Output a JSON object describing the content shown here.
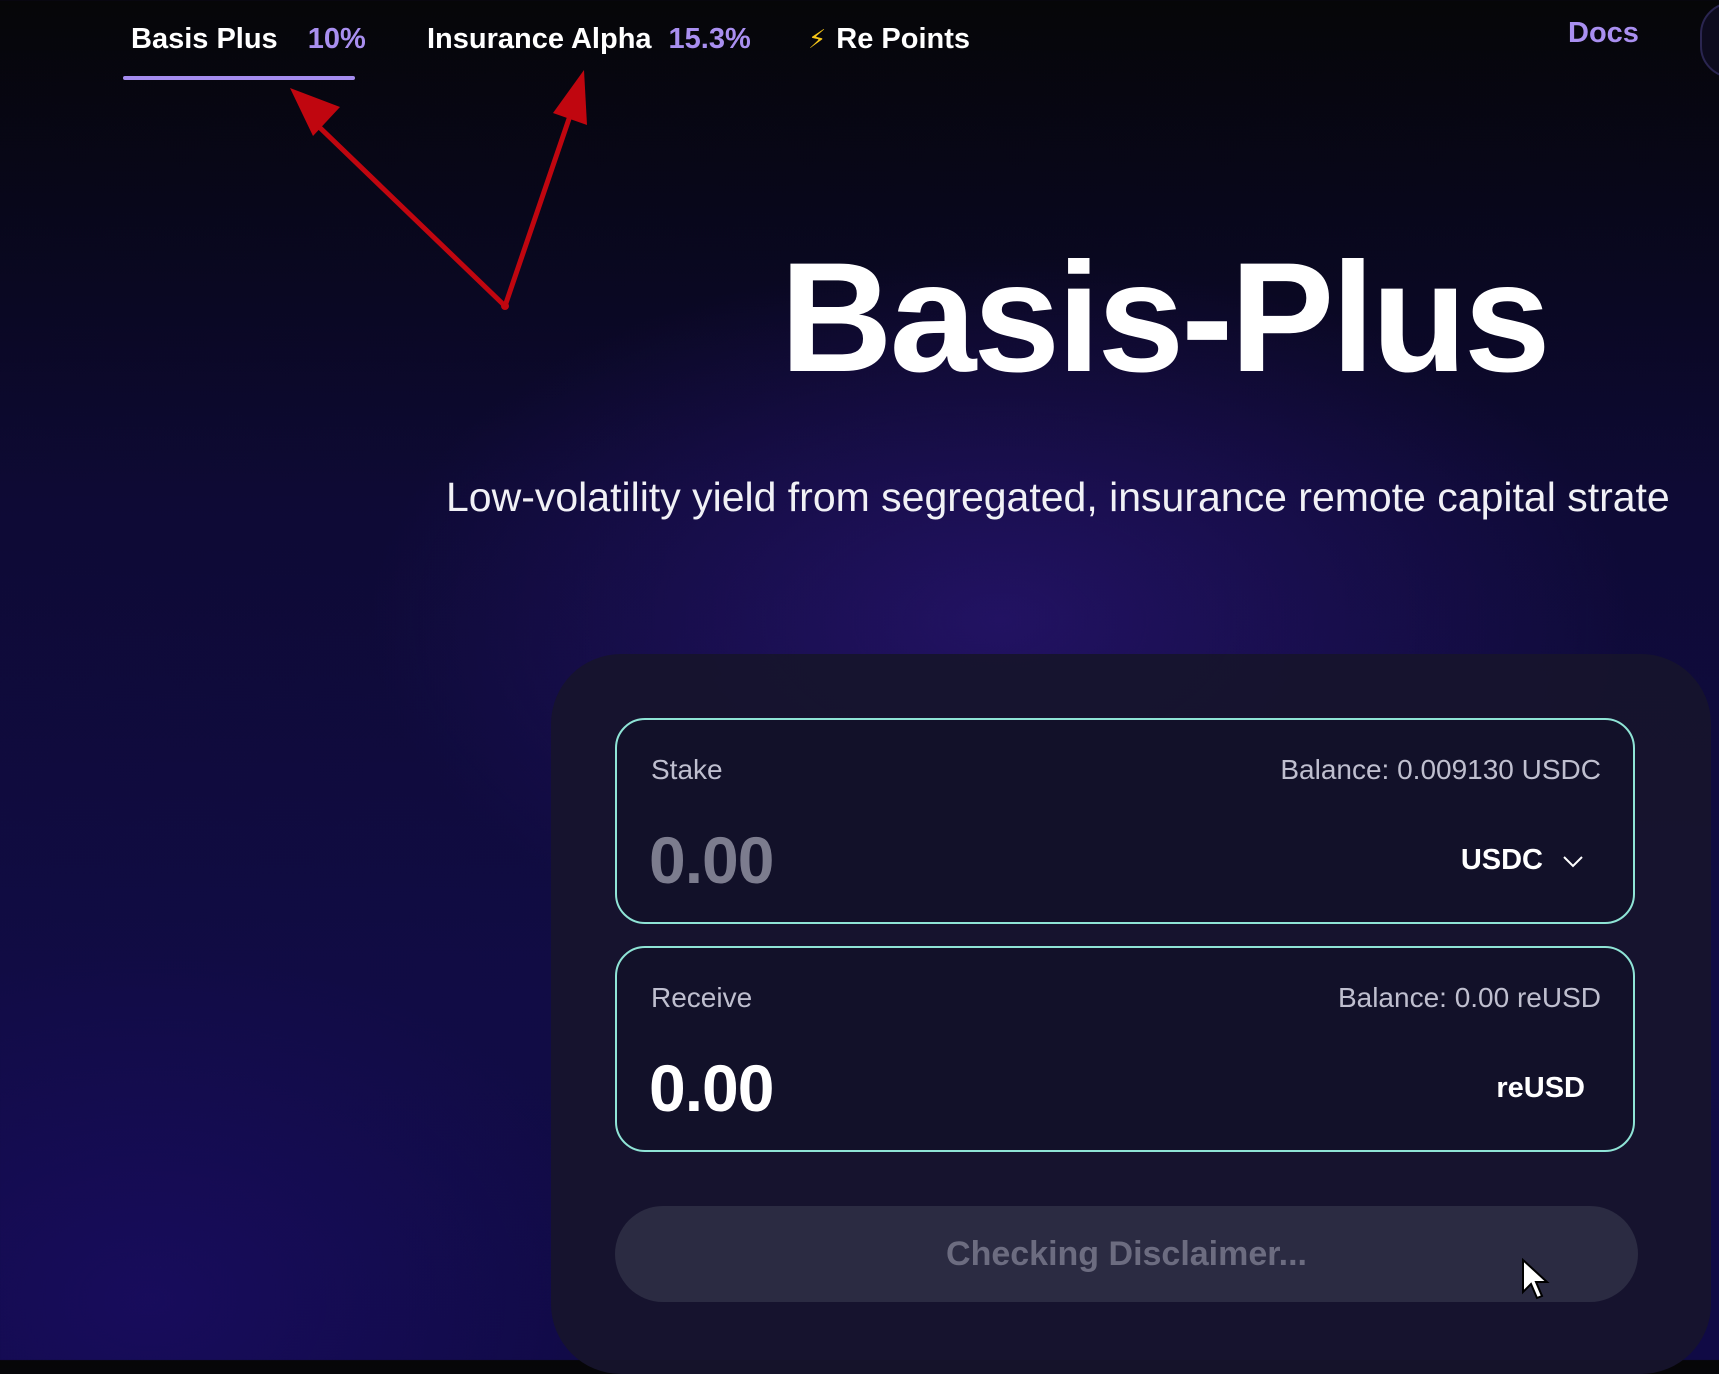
{
  "nav": {
    "tabs": [
      {
        "label": "Basis Plus",
        "rate": "10%"
      },
      {
        "label": "Insurance Alpha",
        "rate": "15.3%"
      },
      {
        "label": "Re Points",
        "icon": "lightning-bolt-icon"
      }
    ],
    "docs_label": "Docs"
  },
  "hero": {
    "title": "Basis-Plus",
    "subtitle": "Low-volatility yield from segregated, insurance remote capital strate"
  },
  "stake": {
    "label": "Stake",
    "balance": "Balance: 0.009130 USDC",
    "amount": "0.00",
    "token": "USDC"
  },
  "receive": {
    "label": "Receive",
    "balance": "Balance: 0.00 reUSD",
    "amount": "0.00",
    "token": "reUSD"
  },
  "action": {
    "label": "Checking Disclaimer..."
  },
  "colors": {
    "accent": "#a98ff0",
    "field_border": "#8fe4d6",
    "annotation_arrow": "#c0060f"
  }
}
